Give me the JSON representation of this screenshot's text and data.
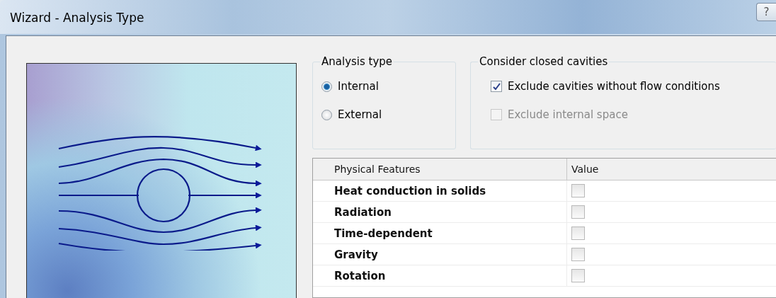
{
  "window": {
    "title": "Wizard - Analysis Type",
    "help_button": "?"
  },
  "analysis_type": {
    "title": "Analysis type",
    "options": [
      {
        "label": "Internal",
        "selected": true
      },
      {
        "label": "External",
        "selected": false
      }
    ]
  },
  "closed_cavities": {
    "title": "Consider closed cavities",
    "options": [
      {
        "label": "Exclude cavities without flow conditions",
        "checked": true,
        "disabled": false
      },
      {
        "label": "Exclude internal space",
        "checked": false,
        "disabled": true
      }
    ]
  },
  "table": {
    "columns": [
      "Physical Features",
      "Value"
    ],
    "rows": [
      {
        "feature": "Heat conduction in solids",
        "checked": false
      },
      {
        "feature": "Radiation",
        "checked": false
      },
      {
        "feature": "Time-dependent",
        "checked": false
      },
      {
        "feature": "Gravity",
        "checked": false
      },
      {
        "feature": "Rotation",
        "checked": false
      }
    ]
  }
}
